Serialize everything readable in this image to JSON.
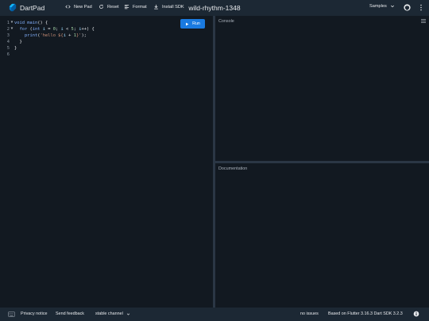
{
  "app": {
    "name": "DartPad",
    "pad_title": "wild-rhythm-1348"
  },
  "toolbar": {
    "new_pad": "New Pad",
    "reset": "Reset",
    "format": "Format",
    "install_sdk": "Install SDK",
    "samples": "Samples"
  },
  "editor": {
    "run_label": "Run",
    "lines": [
      {
        "n": "1",
        "fold": "▼"
      },
      {
        "n": "2",
        "fold": "▼"
      },
      {
        "n": "3",
        "fold": ""
      },
      {
        "n": "4",
        "fold": ""
      },
      {
        "n": "5",
        "fold": ""
      },
      {
        "n": "6",
        "fold": ""
      }
    ],
    "code": {
      "l1": [
        "void",
        " ",
        "main",
        "() {"
      ],
      "l2": [
        "  ",
        "for",
        " (",
        "int",
        " ",
        "i",
        " = ",
        "0",
        "; ",
        "i",
        " < ",
        "5",
        "; ",
        "i",
        "++) {"
      ],
      "l3": [
        "    ",
        "print",
        "(",
        "'hello ${",
        "i",
        " + ",
        "1",
        "}'",
        ");"
      ],
      "l4": [
        "  }"
      ],
      "l5": [
        "}"
      ]
    }
  },
  "console": {
    "title": "Console"
  },
  "docs": {
    "title": "Documentation"
  },
  "footer": {
    "privacy": "Privacy notice",
    "feedback": "Send feedback",
    "channel": "stable channel",
    "issues": "no issues",
    "version": "Based on Flutter 3.16.3 Dart SDK 3.2.3"
  },
  "colors": {
    "accent": "#1a7ae0",
    "background": "#1c2834",
    "editor_bg": "#121921"
  },
  "icons": [
    "dart-logo",
    "code-icon",
    "refresh-icon",
    "format-align-icon",
    "download-icon",
    "chevron-down-icon",
    "github-icon",
    "more-vert-icon",
    "play-icon",
    "clear-console-icon",
    "keyboard-icon",
    "info-icon"
  ]
}
